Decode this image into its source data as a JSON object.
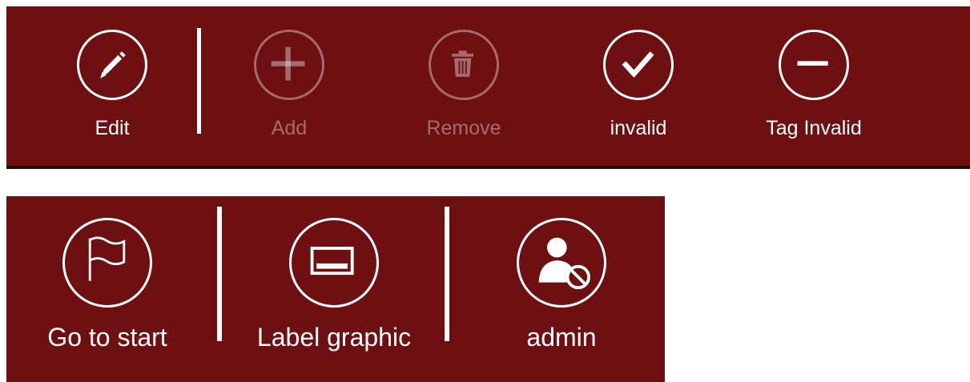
{
  "toolbar_top": {
    "buttons": [
      {
        "label": "Edit",
        "icon": "pencil-icon",
        "enabled": true
      },
      {
        "label": "Add",
        "icon": "plus-icon",
        "enabled": false
      },
      {
        "label": "Remove",
        "icon": "trash-icon",
        "enabled": false
      },
      {
        "label": "invalid",
        "icon": "checkmark-icon",
        "enabled": true
      },
      {
        "label": "Tag Invalid",
        "icon": "minus-icon",
        "enabled": true
      }
    ]
  },
  "toolbar_bottom": {
    "buttons": [
      {
        "label": "Go to start",
        "icon": "flag-icon",
        "enabled": true
      },
      {
        "label": "Label graphic",
        "icon": "label-graphic-icon",
        "enabled": true
      },
      {
        "label": "admin",
        "icon": "user-blocked-icon",
        "enabled": true
      }
    ]
  },
  "colors": {
    "bar_background": "#6e0f12",
    "foreground": "#ffffff",
    "disabled_foreground": "rgba(255,255,255,0.38)"
  }
}
